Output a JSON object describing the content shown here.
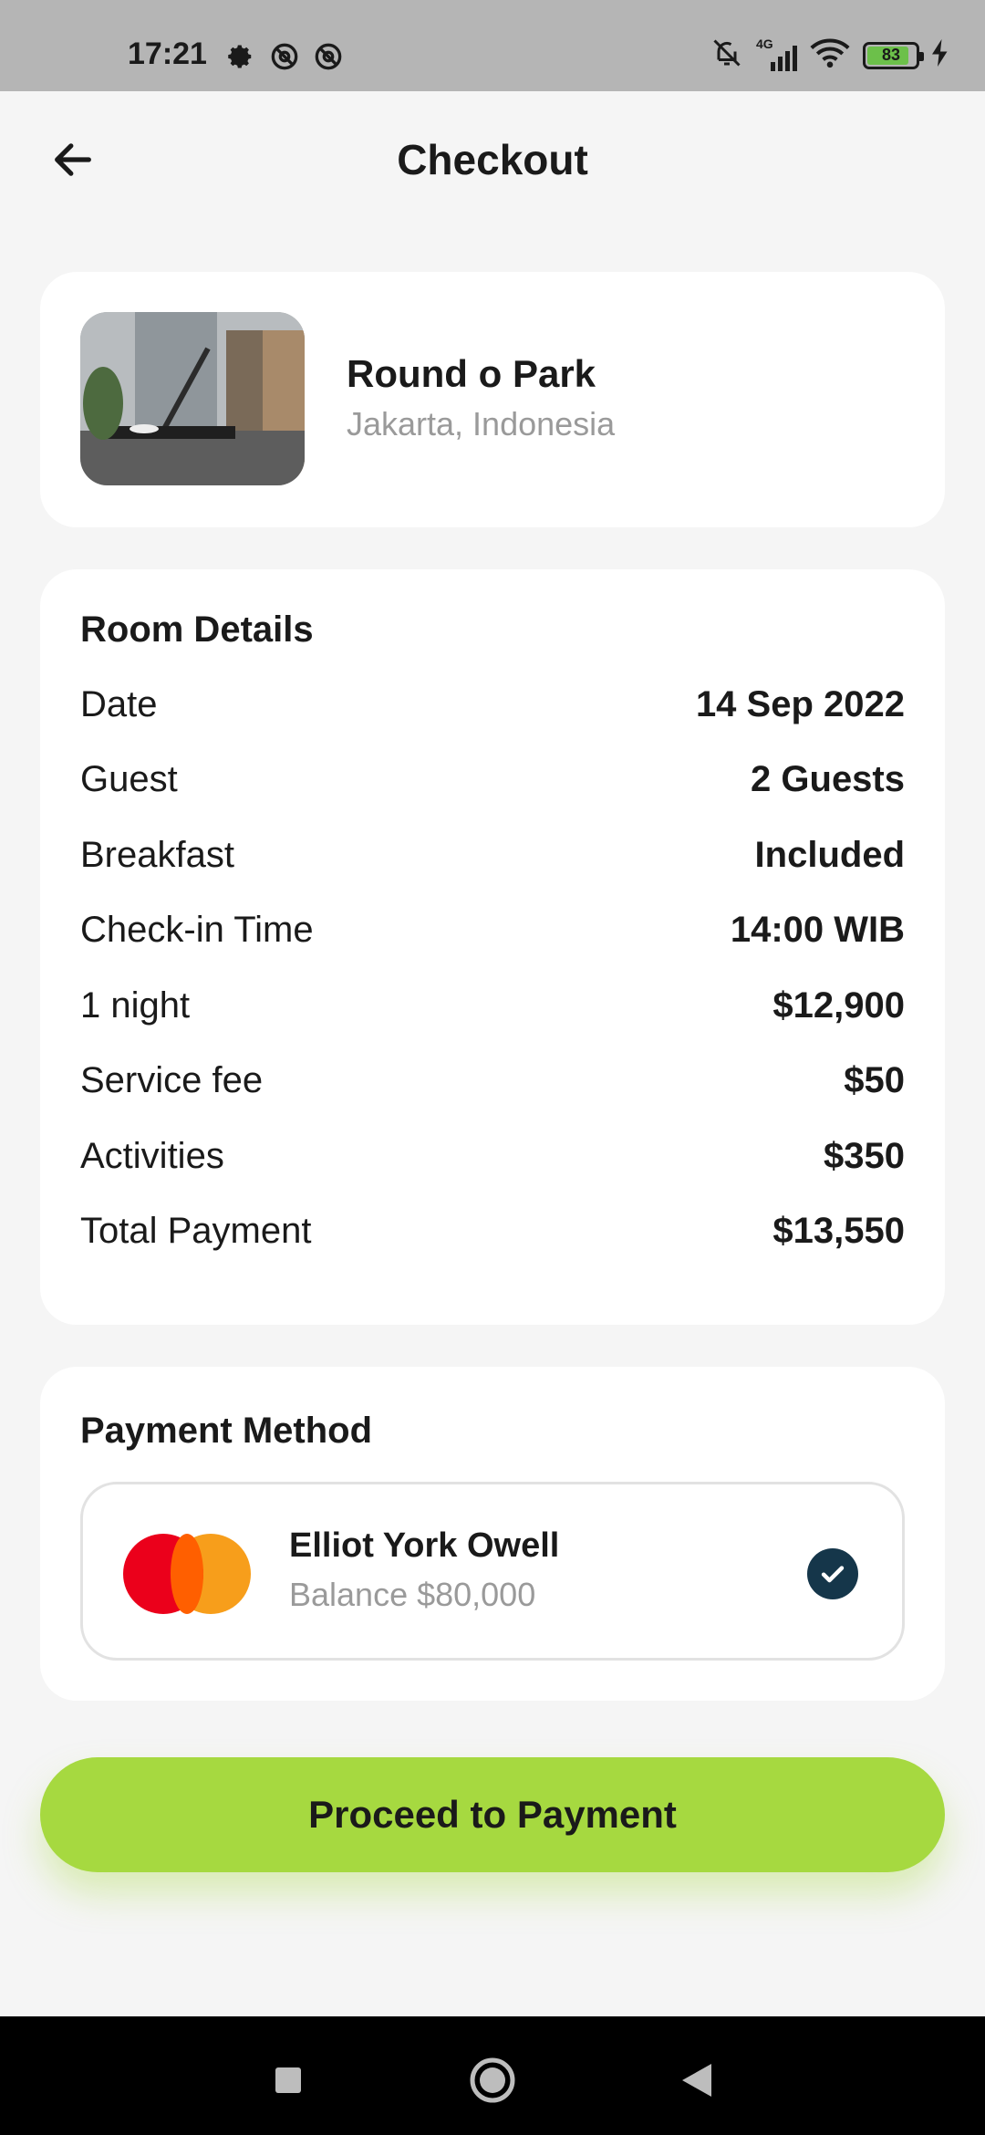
{
  "status_bar": {
    "time": "17:21",
    "network": "4G",
    "battery": "83",
    "icons": [
      "gear-icon",
      "at-icon",
      "at-icon",
      "bell-off-icon",
      "signal-icon",
      "wifi-icon",
      "battery-icon",
      "charging-icon"
    ]
  },
  "header": {
    "title": "Checkout",
    "back_icon": "arrow-left-icon"
  },
  "hotel": {
    "name": "Round o Park",
    "location": "Jakarta, Indonesia"
  },
  "room_details": {
    "title": "Room Details",
    "rows": [
      {
        "label": "Date",
        "value": "14 Sep 2022"
      },
      {
        "label": "Guest",
        "value": "2 Guests"
      },
      {
        "label": "Breakfast",
        "value": "Included"
      },
      {
        "label": "Check-in Time",
        "value": "14:00 WIB"
      },
      {
        "label": "1 night",
        "value": "$12,900"
      },
      {
        "label": "Service fee",
        "value": "$50"
      },
      {
        "label": "Activities",
        "value": "$350"
      },
      {
        "label": "Total Payment",
        "value": "$13,550"
      }
    ]
  },
  "payment": {
    "title": "Payment Method",
    "holder": "Elliot York Owell",
    "balance": "Balance $80,000",
    "selected": true
  },
  "actions": {
    "proceed_label": "Proceed to Payment"
  },
  "colors": {
    "accent": "#a6d940",
    "check": "#15364a",
    "background": "#f5f5f5"
  }
}
